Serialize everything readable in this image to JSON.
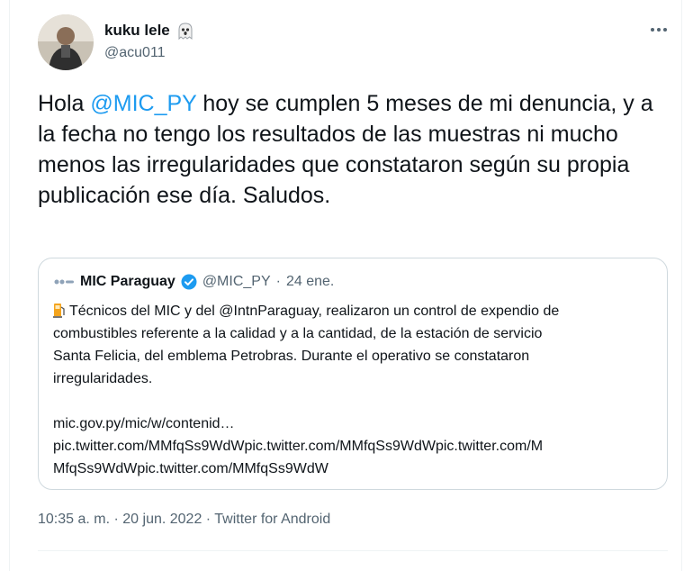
{
  "author": {
    "name": "kuku lele",
    "handle": "@acu011",
    "badge_icon": "ghost-emoji"
  },
  "tweet": {
    "text_before": "Hola ",
    "mention": "@MIC_PY",
    "text_after": " hoy se cumplen 5 meses de mi denuncia, y a la fecha no tengo los resultados de las muestras ni mucho menos las irregularidades que constataron según su propia publicación ese día. Saludos."
  },
  "quote": {
    "name": "MIC Paraguay",
    "handle": "@MIC_PY",
    "separator": "·",
    "date": "24 ene.",
    "lines": [
      "Técnicos del MIC y del @IntnParaguay, realizaron un control de expendio de",
      "combustibles referente a la calidad y a la cantidad, de la estación de servicio",
      "Santa Felicia, del emblema Petrobras. Durante el operativo se constataron",
      "irregularidades."
    ],
    "link_lines": [
      "mic.gov.py/mic/w/contenid…",
      "pic.twitter.com/MMfqSs9WdWpic.twitter.com/MMfqSs9WdWpic.twitter.com/M",
      "MfqSs9WdWpic.twitter.com/MMfqSs9WdW"
    ]
  },
  "meta": {
    "timestamp": "10:35 a. m. · 20 jun. 2022 · Twitter for Android"
  },
  "colors": {
    "link": "#1d9bf0",
    "text": "#0f1419",
    "secondary": "#536471",
    "border": "#cfd9de"
  }
}
